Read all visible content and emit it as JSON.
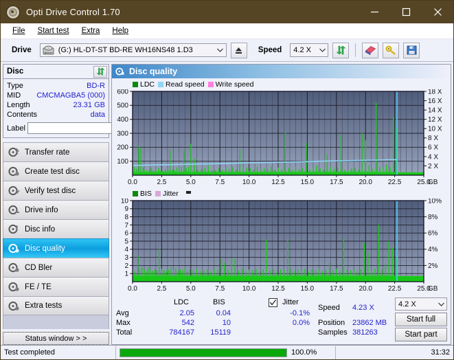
{
  "window": {
    "title": "Opti Drive Control 1.70",
    "icon": "disc-icon",
    "minimize": "─",
    "maximize": "□",
    "close": "✕",
    "titlebar_color": "#554525"
  },
  "menu": [
    {
      "label": "File",
      "mnemonic": "F"
    },
    {
      "label": "Start test",
      "mnemonic": "S"
    },
    {
      "label": "Extra",
      "mnemonic": "x"
    },
    {
      "label": "Help",
      "mnemonic": "H"
    }
  ],
  "toolbar": {
    "drive_label": "Drive",
    "drive_value": "(G:)  HL-DT-ST BD-RE  WH16NS48 1.D3",
    "eject_icon": "eject-icon",
    "speed_label": "Speed",
    "speed_value": "4.2 X",
    "refresh_icon": "refresh-icon",
    "erase_icon": "eraser-icon",
    "key_icon": "key-icon",
    "save_icon": "save-icon"
  },
  "disc": {
    "header": "Disc",
    "refresh_icon": "refresh-icon",
    "rows": [
      {
        "key": "Type",
        "value": "BD-R"
      },
      {
        "key": "MID",
        "value": "CMCMAGBA5 (000)"
      },
      {
        "key": "Length",
        "value": "23.31 GB"
      },
      {
        "key": "Contents",
        "value": "data"
      }
    ],
    "label_key": "Label",
    "label_value": "",
    "label_placeholder": "",
    "cd_icon": "cd-icon"
  },
  "sidebar": {
    "items": [
      {
        "label": "Transfer rate",
        "icon": "disc-test-icon",
        "selected": false
      },
      {
        "label": "Create test disc",
        "icon": "disc-test-icon",
        "selected": false
      },
      {
        "label": "Verify test disc",
        "icon": "disc-test-icon",
        "selected": false
      },
      {
        "label": "Drive info",
        "icon": "disc-test-icon",
        "selected": false
      },
      {
        "label": "Disc info",
        "icon": "disc-test-icon",
        "selected": false
      },
      {
        "label": "Disc quality",
        "icon": "disc-test-icon",
        "selected": true
      },
      {
        "label": "CD Bler",
        "icon": "disc-test-icon",
        "selected": false
      },
      {
        "label": "FE / TE",
        "icon": "disc-test-icon",
        "selected": false
      },
      {
        "label": "Extra tests",
        "icon": "disc-test-icon",
        "selected": false
      }
    ],
    "status_button": "Status window > >"
  },
  "main": {
    "title": "Disc quality",
    "icon": "disc-quality-icon"
  },
  "stats": {
    "col_ldc": "LDC",
    "col_bis": "BIS",
    "row_avg": "Avg",
    "row_max": "Max",
    "row_total": "Total",
    "ldc_avg": "2.05",
    "ldc_max": "542",
    "ldc_total": "784167",
    "bis_avg": "0.04",
    "bis_max": "10",
    "bis_total": "15119",
    "jitter_label": "Jitter",
    "jitter_checked": true,
    "jitter_avg": "-0.1%",
    "jitter_max": "0.0%",
    "speed_label": "Speed",
    "speed_value": "4.23 X",
    "position_label": "Position",
    "position_value": "23862 MB",
    "samples_label": "Samples",
    "samples_value": "381263",
    "speed_select": "4.2 X",
    "start_full": "Start full",
    "start_part": "Start part"
  },
  "statusbar": {
    "message": "Test completed",
    "percent_text": "100.0%",
    "percent": 100,
    "elapsed": "31:32",
    "bar_color": "#0aa80a"
  },
  "chart_data": [
    {
      "type": "bar",
      "id": "top-chart",
      "title": "",
      "xlabel": "GB",
      "ylabel": "",
      "xlim": [
        0,
        25
      ],
      "ylim": [
        0,
        600
      ],
      "y2lim": [
        0,
        18
      ],
      "grid": true,
      "legend_position": "top-left",
      "legend": [
        {
          "name": "LDC",
          "color": "#0c8a0c"
        },
        {
          "name": "Read speed",
          "color": "#8fd6f5"
        },
        {
          "name": "Write speed",
          "color": "#ff7fe0"
        }
      ],
      "xticks": [
        "0.0",
        "2.5",
        "5.0",
        "7.5",
        "10.0",
        "12.5",
        "15.0",
        "17.5",
        "20.0",
        "22.5",
        "25.0"
      ],
      "yticks": [
        "100",
        "200",
        "300",
        "400",
        "500",
        "600"
      ],
      "y2ticks": [
        "2 X",
        "4 X",
        "6 X",
        "8 X",
        "10 X",
        "12 X",
        "14 X",
        "16 X",
        "18 X"
      ],
      "xunit": "GB",
      "series": [
        {
          "name": "LDC",
          "color": "#18c818",
          "kind": "spikes",
          "baseline": 20,
          "x": [
            0.15,
            0.35,
            0.55,
            0.7,
            0.9,
            1.0,
            1.2,
            1.45,
            1.6,
            1.8,
            2.0,
            2.25,
            2.45,
            2.6,
            2.8,
            3.0,
            3.2,
            3.4,
            3.6,
            3.8,
            4.0,
            4.2,
            4.4,
            4.6,
            4.8,
            5.0,
            5.3,
            5.6,
            5.9,
            6.2,
            6.5,
            6.8,
            7.1,
            7.4,
            7.7,
            8.0,
            8.3,
            8.6,
            8.9,
            9.2,
            9.5,
            9.8,
            10.1,
            10.4,
            10.7,
            11.0,
            11.3,
            11.6,
            11.9,
            12.2,
            12.5,
            12.8,
            13.1,
            13.4,
            13.7,
            14.0,
            14.3,
            14.6,
            14.9,
            15.2,
            15.5,
            15.8,
            16.1,
            16.4,
            16.7,
            17.0,
            17.3,
            17.6,
            17.9,
            18.2,
            18.5,
            18.8,
            19.1,
            19.4,
            19.7,
            20.0,
            20.3,
            20.6,
            20.9,
            21.2,
            21.5,
            21.8,
            22.1,
            22.4,
            22.6
          ],
          "y": [
            60,
            45,
            210,
            190,
            55,
            40,
            35,
            40,
            55,
            30,
            40,
            50,
            35,
            30,
            45,
            40,
            180,
            40,
            35,
            55,
            45,
            60,
            175,
            50,
            60,
            225,
            120,
            40,
            45,
            55,
            70,
            35,
            40,
            50,
            40,
            55,
            45,
            60,
            40,
            185,
            45,
            55,
            50,
            40,
            60,
            35,
            50,
            45,
            60,
            40,
            55,
            45,
            310,
            50,
            40,
            60,
            45,
            50,
            230,
            40,
            55,
            70,
            50,
            40,
            150,
            60,
            45,
            55,
            290,
            40,
            35,
            50,
            55,
            40,
            300,
            250,
            70,
            45,
            520,
            60,
            55,
            75,
            60,
            420,
            340
          ]
        },
        {
          "name": "Read speed",
          "color": "#8fd6f5",
          "kind": "line",
          "axis": "y2",
          "x": [
            0.0,
            1.0,
            2.0,
            3.0,
            4.0,
            5.0,
            6.0,
            7.0,
            8.0,
            9.0,
            10.0,
            11.0,
            12.0,
            13.0,
            14.0,
            15.0,
            16.0,
            17.0,
            18.0,
            19.0,
            20.0,
            21.0,
            22.0,
            22.7
          ],
          "y": [
            2.1,
            2.15,
            2.2,
            2.25,
            2.3,
            2.35,
            2.4,
            2.45,
            2.5,
            2.6,
            2.65,
            2.7,
            2.75,
            2.8,
            2.85,
            2.9,
            3.0,
            3.05,
            3.1,
            3.15,
            3.2,
            3.25,
            3.3,
            3.35
          ]
        },
        {
          "name": "end-marker",
          "color": "#4fd0ff",
          "kind": "vline",
          "x": 22.7
        }
      ]
    },
    {
      "type": "bar",
      "id": "bottom-chart",
      "title": "",
      "xlabel": "GB",
      "ylabel": "",
      "xlim": [
        0,
        25
      ],
      "ylim": [
        0,
        10
      ],
      "y2lim": [
        0,
        10
      ],
      "grid": true,
      "legend_position": "top-left",
      "legend": [
        {
          "name": "BIS",
          "color": "#0c8a0c"
        },
        {
          "name": "Jitter",
          "color": "#d9a8d9"
        }
      ],
      "xticks": [
        "0.0",
        "2.5",
        "5.0",
        "7.5",
        "10.0",
        "12.5",
        "15.0",
        "17.5",
        "20.0",
        "22.5",
        "25.0"
      ],
      "yticks": [
        "1",
        "2",
        "3",
        "4",
        "5",
        "6",
        "7",
        "8",
        "9",
        "10"
      ],
      "y2ticks": [
        "2%",
        "4%",
        "6%",
        "8%",
        "10%"
      ],
      "xunit": "GB",
      "series": [
        {
          "name": "BIS",
          "color": "#18c818",
          "kind": "spikes",
          "baseline": 0.7,
          "x": [
            0.2,
            0.45,
            0.6,
            0.8,
            1.0,
            1.15,
            1.35,
            1.5,
            1.7,
            1.9,
            2.1,
            2.3,
            2.5,
            2.7,
            2.9,
            3.1,
            3.3,
            3.5,
            3.7,
            3.9,
            4.1,
            4.3,
            4.5,
            4.7,
            4.9,
            5.2,
            5.5,
            5.8,
            6.1,
            6.4,
            6.7,
            7.0,
            7.3,
            7.6,
            7.9,
            8.2,
            8.5,
            8.8,
            9.1,
            9.4,
            9.7,
            10.0,
            10.3,
            10.6,
            10.9,
            11.2,
            11.5,
            11.8,
            12.1,
            12.4,
            12.7,
            13.0,
            13.3,
            13.6,
            13.9,
            14.2,
            14.5,
            14.8,
            15.1,
            15.4,
            15.7,
            16.0,
            16.3,
            16.6,
            16.9,
            17.2,
            17.5,
            17.8,
            18.1,
            18.4,
            18.7,
            19.0,
            19.3,
            19.6,
            19.9,
            20.2,
            20.5,
            20.8,
            21.1,
            21.4,
            21.7,
            22.0,
            22.3,
            22.6
          ],
          "y": [
            1.3,
            3.2,
            1.6,
            1.8,
            1.5,
            1.3,
            1.7,
            1.4,
            1.3,
            1.5,
            1.4,
            4.0,
            1.6,
            1.4,
            1.3,
            1.5,
            1.8,
            1.4,
            1.6,
            1.3,
            1.5,
            1.4,
            1.7,
            1.3,
            1.5,
            1.4,
            1.6,
            1.3,
            1.4,
            1.5,
            1.3,
            1.6,
            1.4,
            2.8,
            2.3,
            1.5,
            2.9,
            2.8,
            1.4,
            1.6,
            1.3,
            1.5,
            1.4,
            1.6,
            1.3,
            1.5,
            5.2,
            1.4,
            1.6,
            1.3,
            1.5,
            1.4,
            5.3,
            1.6,
            1.3,
            1.5,
            1.4,
            1.6,
            1.3,
            1.5,
            1.4,
            1.6,
            1.3,
            1.5,
            2.4,
            1.4,
            1.6,
            1.3,
            5.5,
            1.5,
            1.4,
            1.6,
            1.3,
            1.5,
            4.8,
            3.6,
            1.4,
            1.6,
            7.0,
            1.5,
            2.2,
            5.0,
            4.2,
            3.0
          ]
        },
        {
          "name": "end-marker",
          "color": "#4fd0ff",
          "kind": "vline",
          "x": 22.7
        }
      ]
    }
  ]
}
